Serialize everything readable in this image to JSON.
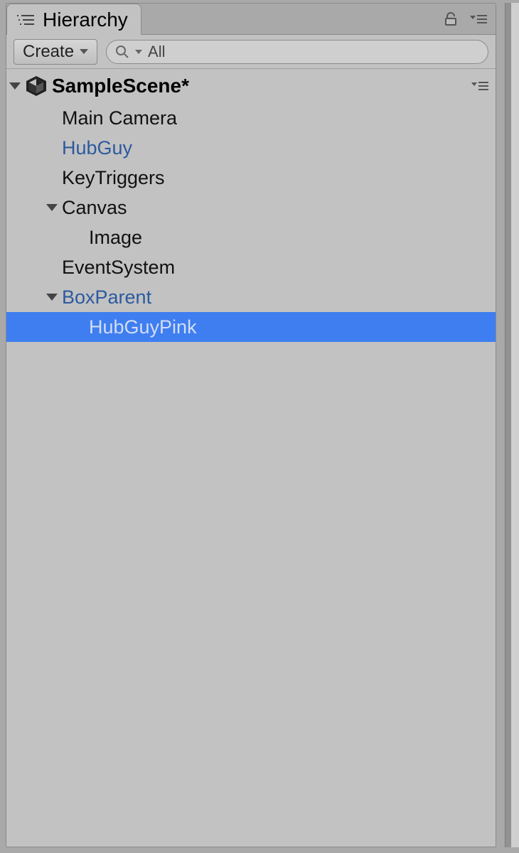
{
  "tab": {
    "title": "Hierarchy"
  },
  "toolbar": {
    "create_label": "Create",
    "search_value": "All"
  },
  "scene": {
    "name": "SampleScene*"
  },
  "items": {
    "main_camera": "Main Camera",
    "hubguy": "HubGuy",
    "keytriggers": "KeyTriggers",
    "canvas": "Canvas",
    "image": "Image",
    "eventsystem": "EventSystem",
    "boxparent": "BoxParent",
    "hubguypink": "HubGuyPink"
  }
}
